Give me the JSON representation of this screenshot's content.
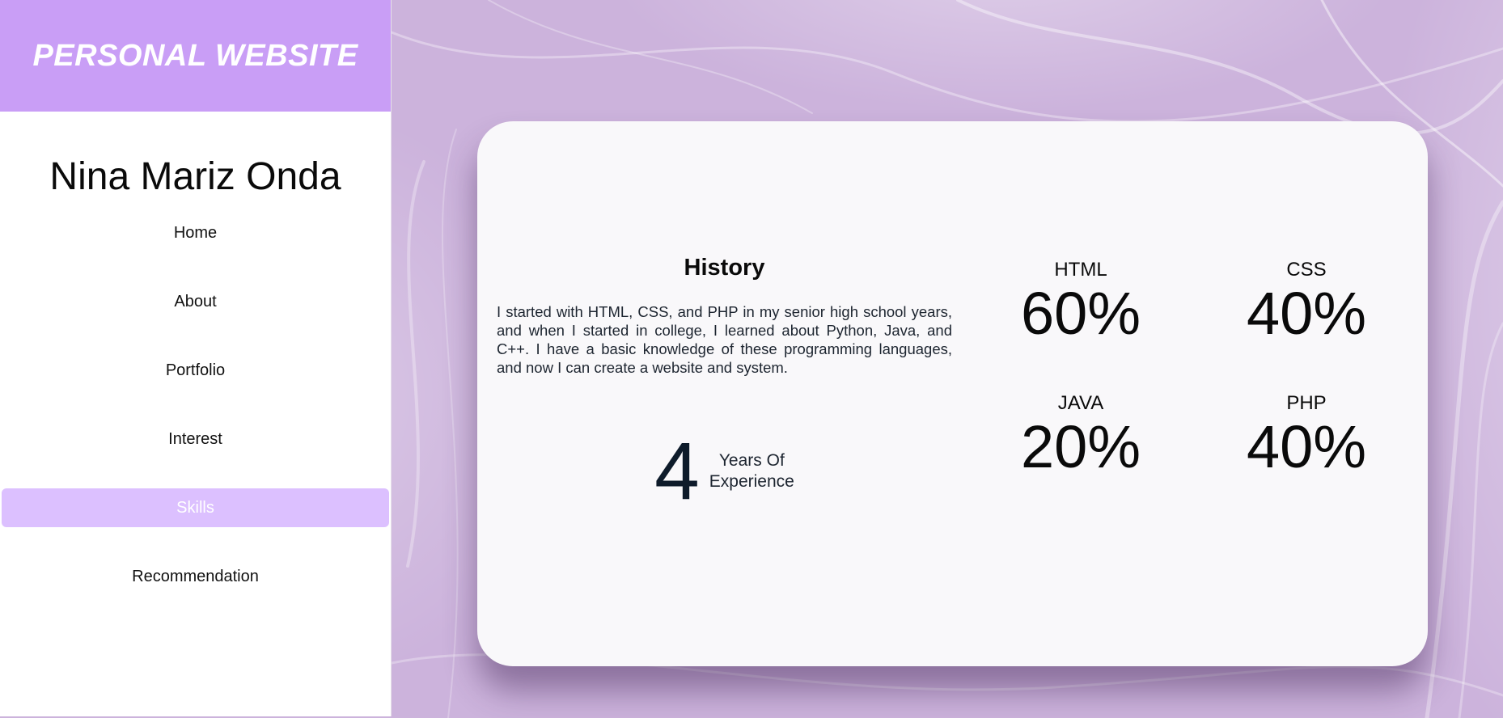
{
  "sidebar": {
    "brand": "PERSONAL WEBSITE",
    "owner_name": "Nina Mariz Onda",
    "nav": [
      {
        "label": "Home"
      },
      {
        "label": "About"
      },
      {
        "label": "Portfolio"
      },
      {
        "label": "Interest"
      },
      {
        "label": "Skills",
        "active": true
      },
      {
        "label": "Recommendation"
      }
    ]
  },
  "history": {
    "title": "History",
    "text": "I started with HTML, CSS, and PHP in my senior high school years, and when I started in college, I learned about Python, Java, and C++. I have a basic knowledge of these programming languages, and now I can create a website and system.",
    "years_value": "4",
    "years_label_line1": "Years Of",
    "years_label_line2": "Experience"
  },
  "skills": [
    {
      "name": "HTML",
      "percent": "60%"
    },
    {
      "name": "CSS",
      "percent": "40%"
    },
    {
      "name": "JAVA",
      "percent": "20%"
    },
    {
      "name": "PHP",
      "percent": "40%"
    }
  ],
  "colors": {
    "brand_bg": "#c99ef6",
    "active_nav_bg": "#dcc0ff",
    "page_bg": "#ccb3dc",
    "card_bg": "#f9f8fa"
  }
}
